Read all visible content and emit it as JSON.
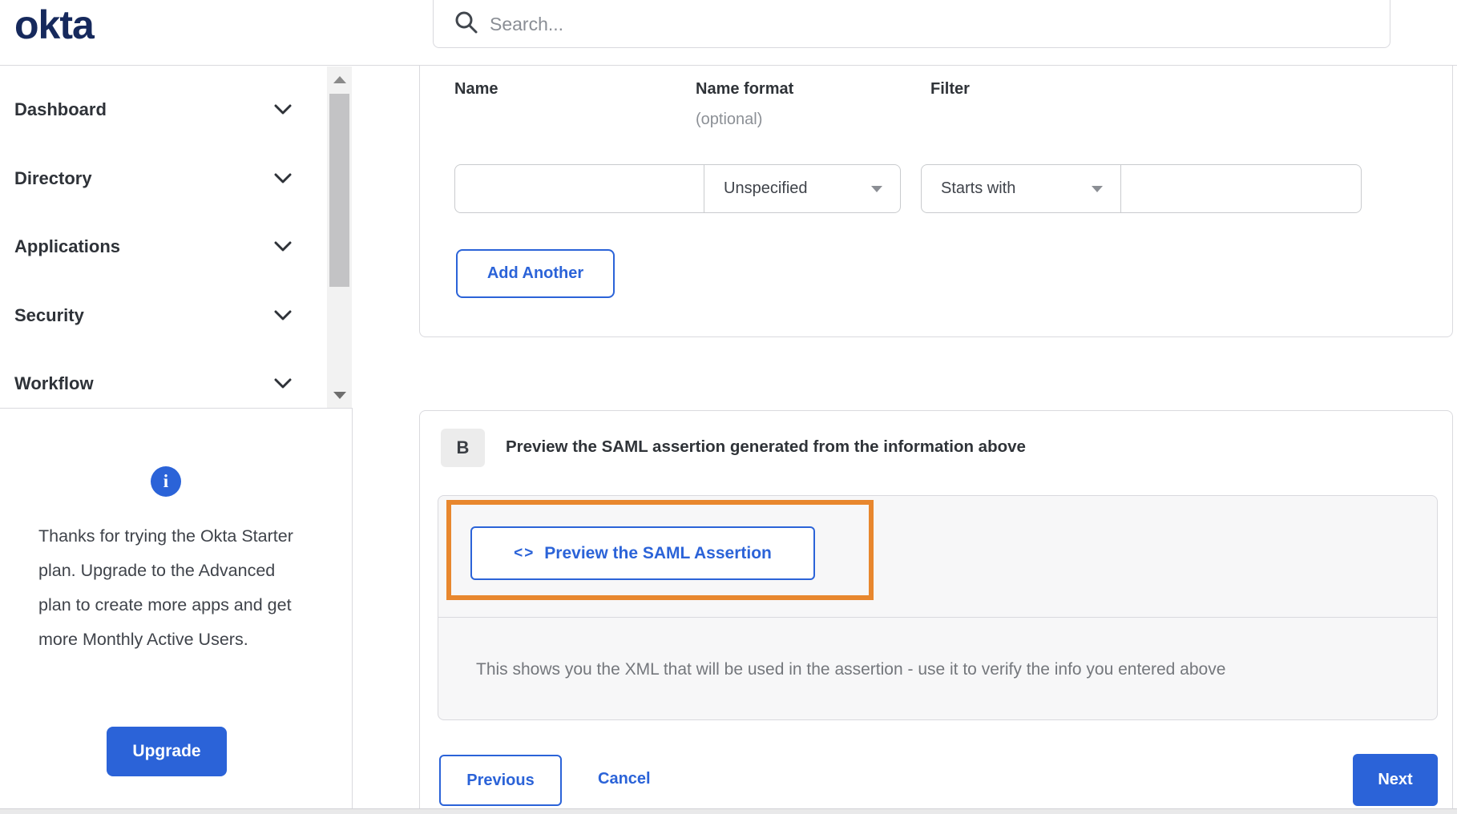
{
  "header": {
    "logo": "okta",
    "search": {
      "placeholder": "Search..."
    }
  },
  "sidebar": {
    "nav": [
      {
        "label": "Dashboard"
      },
      {
        "label": "Directory"
      },
      {
        "label": "Applications"
      },
      {
        "label": "Security"
      },
      {
        "label": "Workflow"
      }
    ],
    "promo": {
      "text": "Thanks for trying the Okta Starter plan. Upgrade to the Advanced plan to create more apps and get more Monthly Active Users.",
      "upgrade_label": "Upgrade"
    }
  },
  "main": {
    "attribute_form": {
      "name_label": "Name",
      "name_format_label": "Name format",
      "name_format_note": "(optional)",
      "filter_label": "Filter",
      "row": {
        "name_value": "",
        "name_format_value": "Unspecified",
        "filter_type_value": "Starts with",
        "filter_value": ""
      },
      "add_another_label": "Add Another"
    },
    "section_b": {
      "badge": "B",
      "title": "Preview the SAML assertion generated from the information above",
      "preview_icon": "<>",
      "preview_button_label": "Preview the SAML Assertion",
      "description": "This shows you the XML that will be used in the assertion - use it to verify the info you entered above"
    },
    "footer": {
      "previous_label": "Previous",
      "cancel_label": "Cancel",
      "next_label": "Next"
    }
  },
  "colors": {
    "accent_blue": "#2b63d8",
    "logo_navy": "#16295c",
    "highlight_orange": "#e8872e"
  }
}
